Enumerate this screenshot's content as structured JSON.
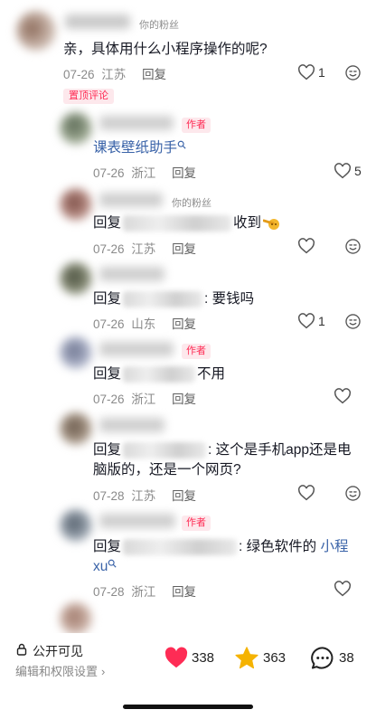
{
  "comments": [
    {
      "tag": "你的粉丝",
      "text": "亲，具体用什么小程序操作的呢?",
      "date": "07-26",
      "region": "江苏",
      "reply": "回复",
      "likes": "1"
    }
  ],
  "pinned_label": "置顶评论",
  "replies": [
    {
      "tag": "作者",
      "link_text": "课表壁纸助手",
      "search_icon": "search-icon",
      "date": "07-26",
      "region": "浙江",
      "reply": "回复",
      "likes": "5"
    },
    {
      "tag": "你的粉丝",
      "prefix": "回复",
      "text": "收到",
      "emoji": "thumbs-pointing-emoji",
      "date": "07-26",
      "region": "江苏",
      "reply": "回复",
      "likes": ""
    },
    {
      "prefix": "回复",
      "text": ": 要钱吗",
      "date": "07-26",
      "region": "山东",
      "reply": "回复",
      "likes": "1"
    },
    {
      "tag": "作者",
      "prefix": "回复",
      "text": "不用",
      "date": "07-26",
      "region": "浙江",
      "reply": "回复",
      "likes": ""
    },
    {
      "prefix": "回复",
      "text": ": 这个是手机app还是电",
      "text2": "脑版的，还是一个网页?",
      "date": "07-28",
      "region": "江苏",
      "reply": "回复",
      "likes": ""
    },
    {
      "tag": "作者",
      "prefix": "回复",
      "text": ": 绿色软件的 ",
      "link_text": "小程",
      "link_text2": "xu",
      "date": "07-28",
      "region": "浙江",
      "reply": "回复",
      "likes": ""
    }
  ],
  "bottom": {
    "privacy_label": "公开可见",
    "edit_label": "编辑和权限设置",
    "likes": "338",
    "favorites": "363",
    "comments": "38"
  },
  "colors": {
    "accent": "#fe2c55",
    "link": "#3a63a8",
    "star": "#f5b301"
  }
}
